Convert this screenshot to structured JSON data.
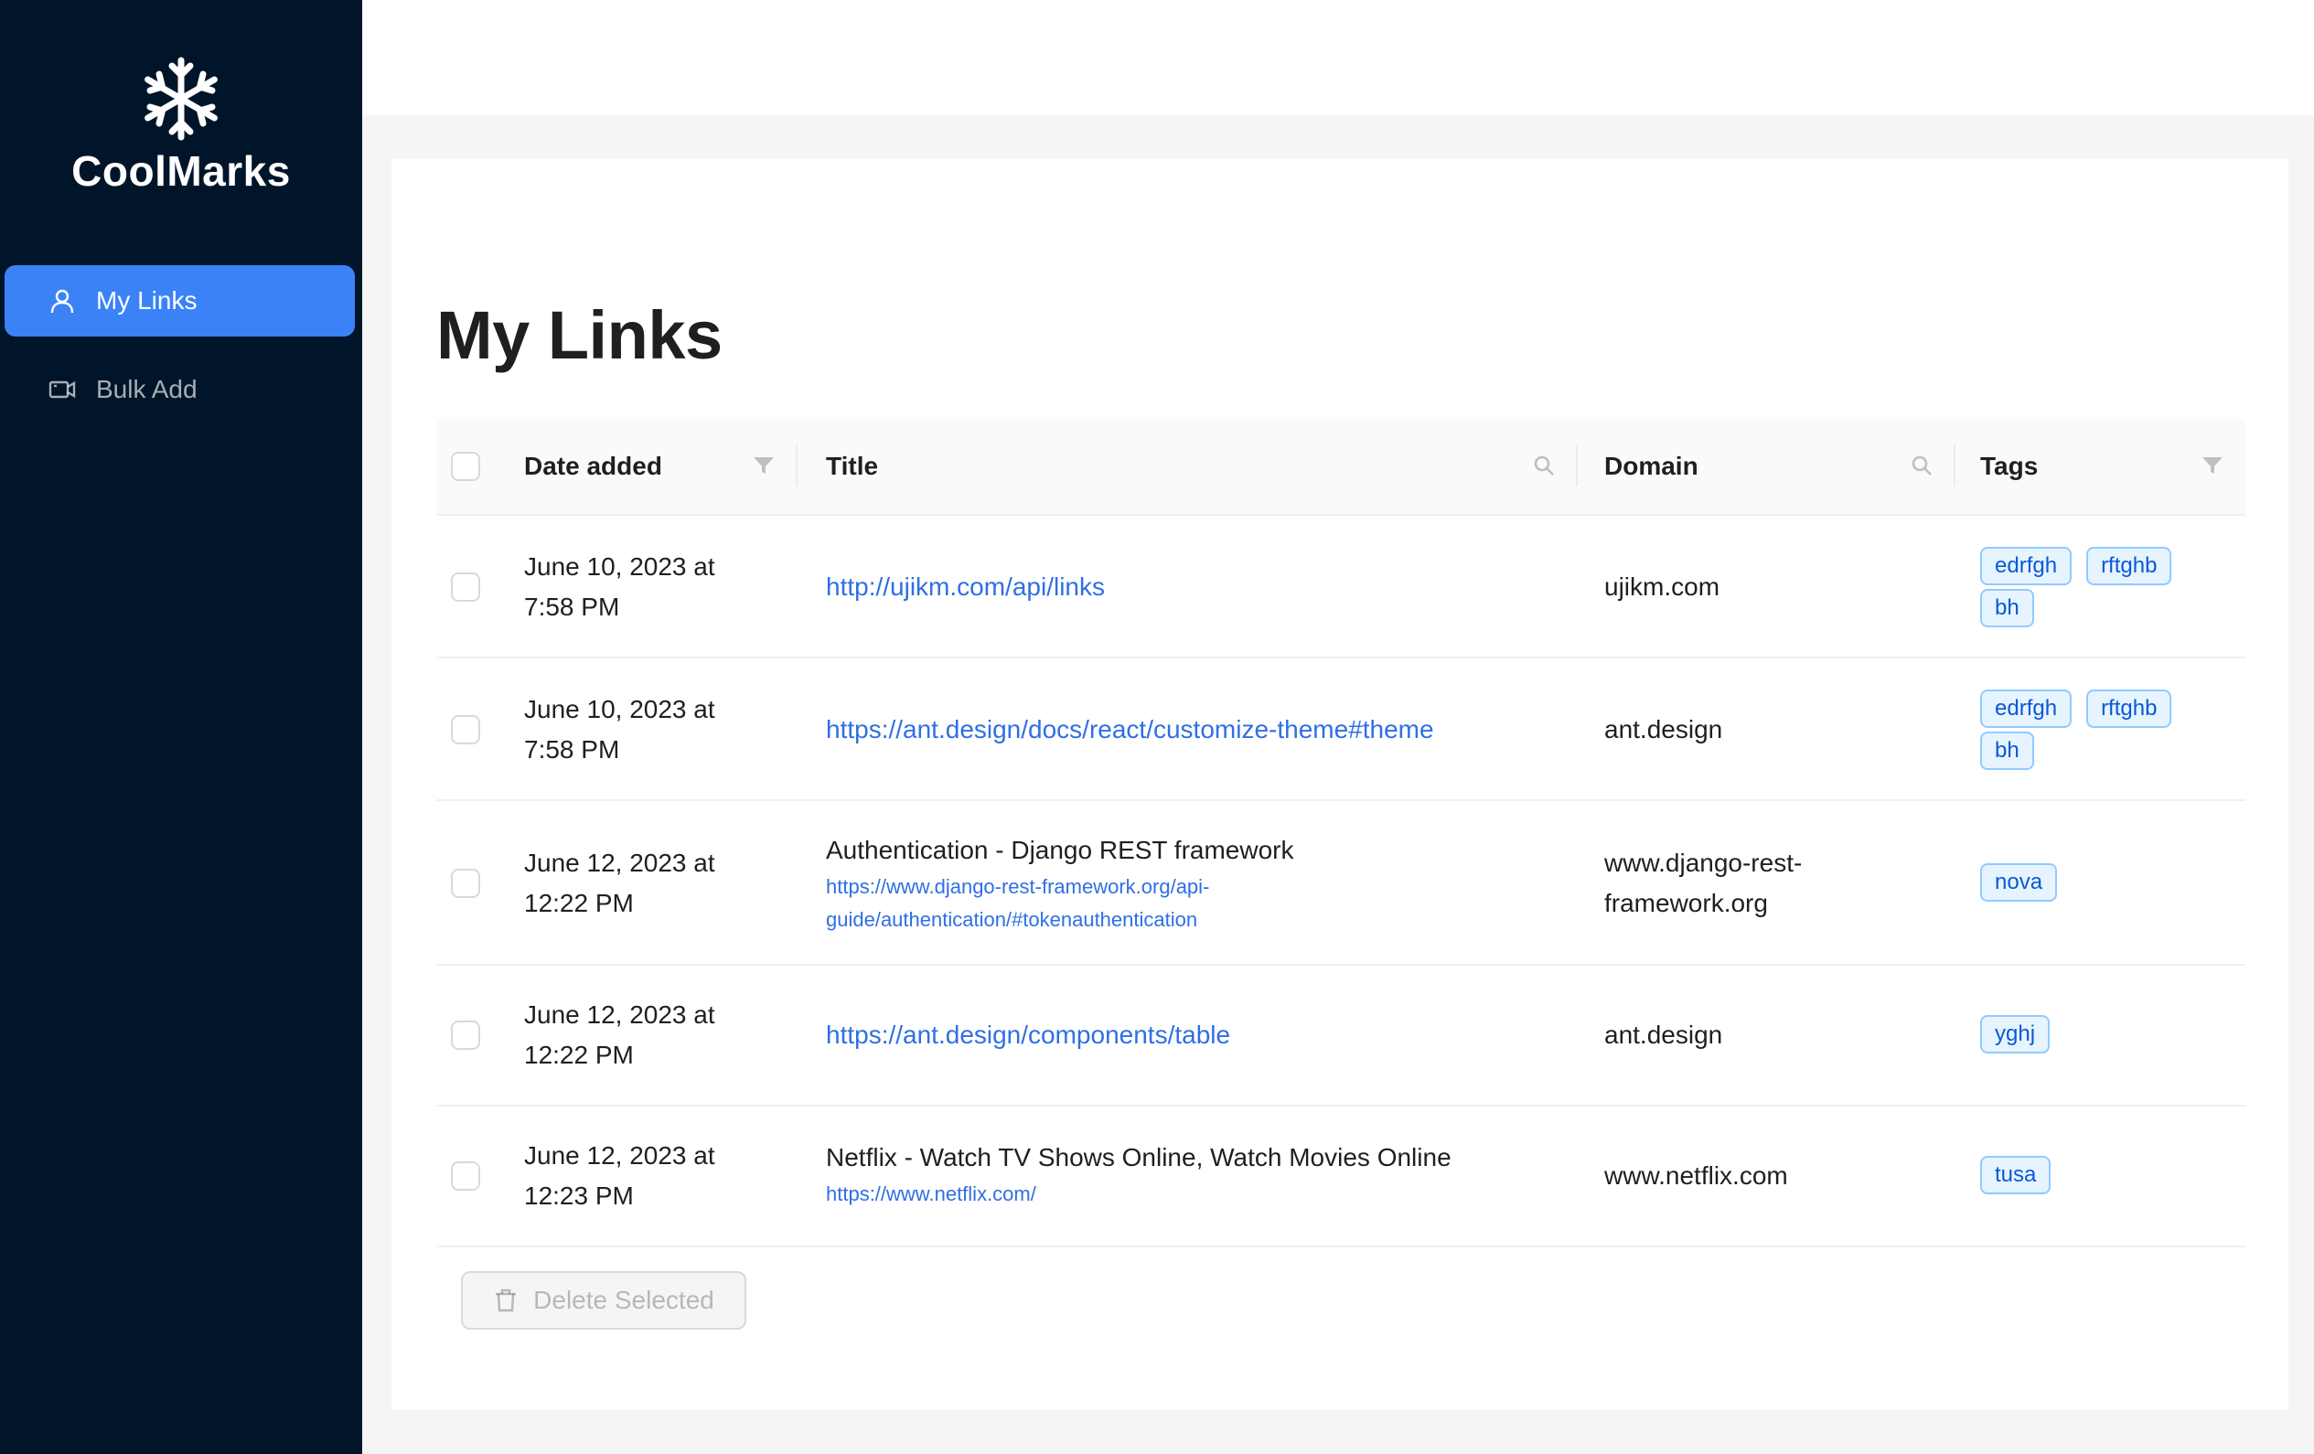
{
  "app": {
    "name": "CoolMarks",
    "logo_icon": "snowflake-icon"
  },
  "sidebar": {
    "items": [
      {
        "label": "My Links",
        "icon": "user-icon",
        "active": true
      },
      {
        "label": "Bulk Add",
        "icon": "video-camera-icon",
        "active": false
      }
    ]
  },
  "page": {
    "title": "My Links"
  },
  "table": {
    "columns": [
      {
        "label": "Date added",
        "icon": "filter-icon"
      },
      {
        "label": "Title",
        "icon": "search-icon"
      },
      {
        "label": "Domain",
        "icon": "search-icon"
      },
      {
        "label": "Tags",
        "icon": "filter-icon"
      }
    ],
    "rows": [
      {
        "date_line1": "June 10, 2023 at",
        "date_line2": "7:58 PM",
        "title": "",
        "url": "http://ujikm.com/api/links",
        "domain_line1": "ujikm.com",
        "domain_line2": "",
        "tags": [
          "edrfgh",
          "rftghb",
          "bh"
        ]
      },
      {
        "date_line1": "June 10, 2023 at",
        "date_line2": "7:58 PM",
        "title": "",
        "url": "https://ant.design/docs/react/customize-theme#theme",
        "domain_line1": "ant.design",
        "domain_line2": "",
        "tags": [
          "edrfgh",
          "rftghb",
          "bh"
        ]
      },
      {
        "date_line1": "June 12, 2023 at",
        "date_line2": "12:22 PM",
        "title": "Authentication - Django REST framework",
        "url_line1": "https://www.django-rest-framework.org/api-",
        "url_line2": "guide/authentication/#tokenauthentication",
        "domain_line1": "www.django-rest-",
        "domain_line2": "framework.org",
        "tags": [
          "nova"
        ]
      },
      {
        "date_line1": "June 12, 2023 at",
        "date_line2": "12:22 PM",
        "title": "",
        "url": "https://ant.design/components/table",
        "domain_line1": "ant.design",
        "domain_line2": "",
        "tags": [
          "yghj"
        ]
      },
      {
        "date_line1": "June 12, 2023 at",
        "date_line2": "12:23 PM",
        "title": "Netflix - Watch TV Shows Online, Watch Movies Online",
        "url": "https://www.netflix.com/",
        "domain_line1": "www.netflix.com",
        "domain_line2": "",
        "tags": [
          "tusa"
        ]
      }
    ]
  },
  "actions": {
    "delete_label": "Delete Selected",
    "delete_icon": "trash-icon"
  },
  "colors": {
    "sidebar_bg": "#001529",
    "accent": "#3b82f6",
    "link": "#2f6fe4",
    "tag_bg": "#e6f4ff",
    "tag_border": "#91caff"
  }
}
